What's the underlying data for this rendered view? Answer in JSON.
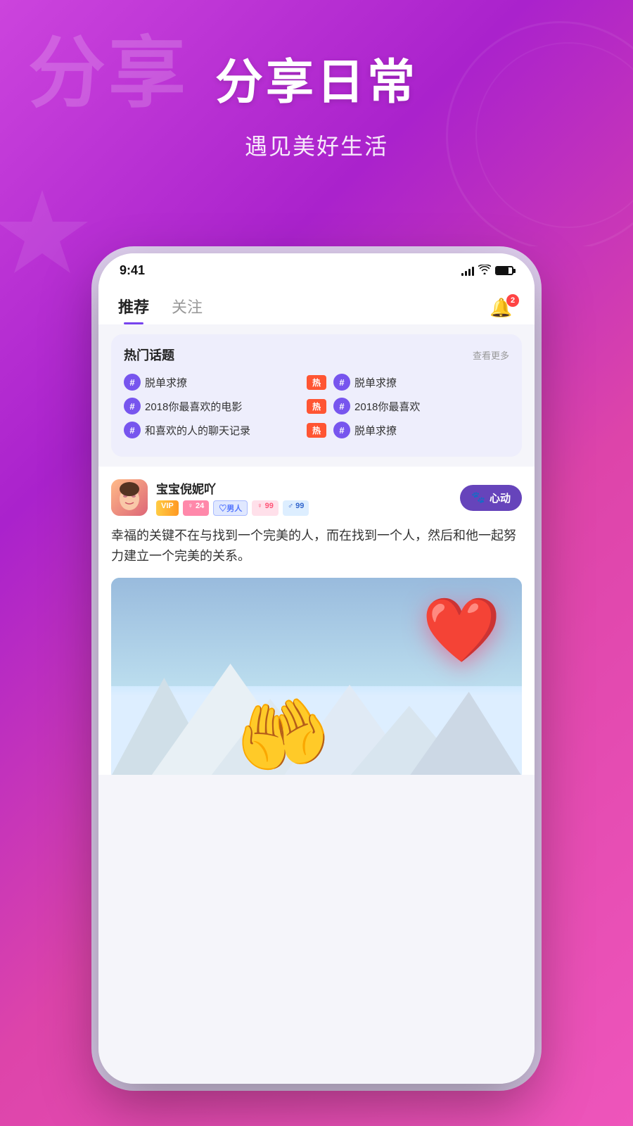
{
  "background": {
    "gradient_start": "#cc44dd",
    "gradient_end": "#ee55bb"
  },
  "header": {
    "faded_text": "分享",
    "main_title": "分享日常",
    "subtitle": "遇见美好生活"
  },
  "status_bar": {
    "time": "9:41",
    "battery_badge": ""
  },
  "nav": {
    "tab_recommended": "推荐",
    "tab_following": "关注",
    "bell_badge": "2"
  },
  "hot_topics": {
    "title": "热门话题",
    "view_more": "查看更多",
    "rows": [
      {
        "left_text": "脱单求撩",
        "hot_badge": "热",
        "right_text": "脱单求撩"
      },
      {
        "left_text": "2018你最喜欢的电影",
        "hot_badge": "热",
        "right_text": "2018你最喜欢"
      },
      {
        "left_text": "和喜欢的人的聊天记录",
        "hot_badge": "热",
        "right_text": "脱单求撩"
      }
    ]
  },
  "post": {
    "user_name": "宝宝倪妮吖",
    "tags": {
      "vip": "VIP",
      "female": "♀ 24",
      "user_type": "♡男人",
      "female_num": "♀ 99",
      "male_num": "♂ 99"
    },
    "heart_button_label": "心动",
    "content": "幸福的关键不在与找到一个完美的人，而在找到一个人，然后和他一起努力建立一个完美的关系。",
    "image_alt": "mountain heart scene"
  },
  "icons": {
    "bell": "🔔",
    "hash": "#",
    "heart": "❤️",
    "paw": "🐾"
  }
}
